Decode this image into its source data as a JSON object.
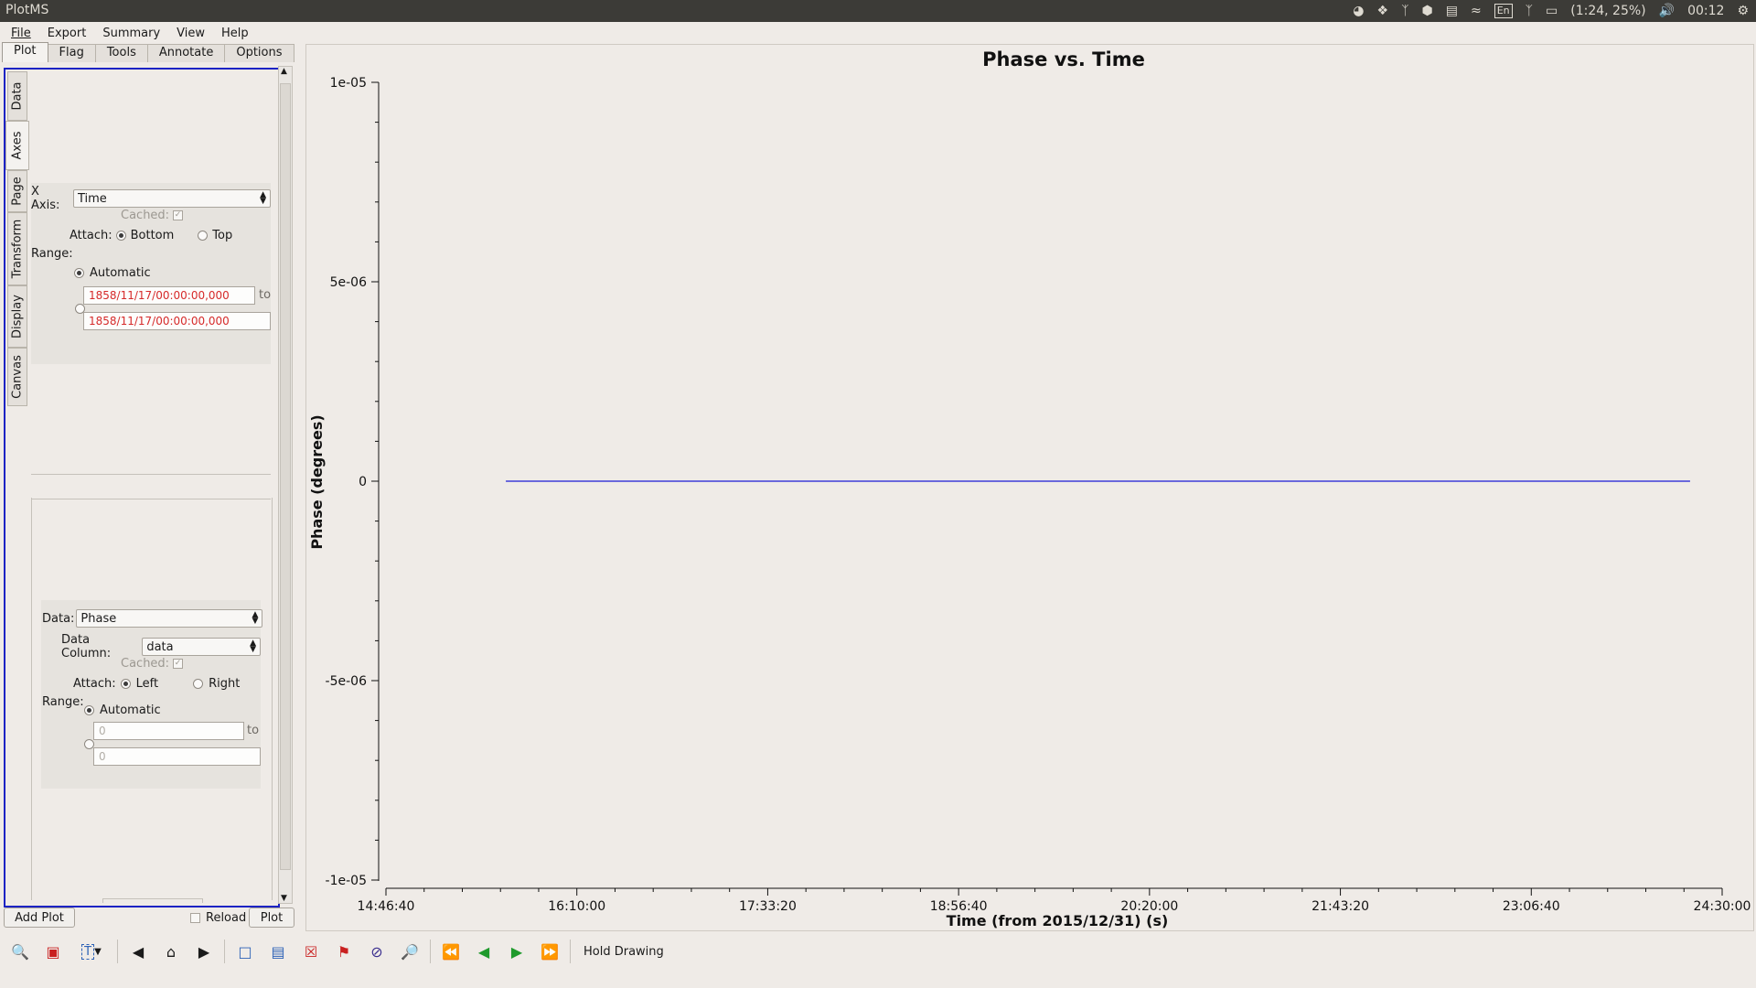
{
  "topbar": {
    "app_title": "PlotMS",
    "tray": {
      "keyboard": "En",
      "battery": "(1:24, 25%)",
      "clock": "00:12"
    }
  },
  "menu": {
    "items": [
      "File",
      "Export",
      "Summary",
      "View",
      "Help"
    ]
  },
  "tabs": [
    "Plot",
    "Flag",
    "Tools",
    "Annotate",
    "Options"
  ],
  "side_tabs": [
    "Data",
    "Axes",
    "Page",
    "Transform",
    "Display",
    "Canvas"
  ],
  "x_axis": {
    "label": "X Axis:",
    "value": "Time",
    "cached_label": "Cached:",
    "attach_label": "Attach:",
    "attach_options": [
      "Bottom",
      "Top"
    ],
    "range_label": "Range:",
    "automatic_label": "Automatic",
    "range_from": "1858/11/17/00:00:00,000",
    "range_to_label": "to",
    "range_to": "1858/11/17/00:00:00,000"
  },
  "y_axis": {
    "data_label": "Data:",
    "data_value": "Phase",
    "column_label": "Data Column:",
    "column_value": "data",
    "cached_label": "Cached:",
    "attach_label": "Attach:",
    "attach_options": [
      "Left",
      "Right"
    ],
    "range_label": "Range:",
    "automatic_label": "Automatic",
    "range_from": "0",
    "range_to_label": "to",
    "range_to": "0"
  },
  "buttons": {
    "add_plot": "Add Plot",
    "reload": "Reload",
    "plot": "Plot"
  },
  "toolbar": {
    "hold_drawing": "Hold Drawing"
  },
  "chart_data": {
    "type": "line",
    "title": "Phase vs. Time",
    "xlabel": "Time (from 2015/12/31) (s)",
    "ylabel": "Phase (degrees)",
    "x_ticks": [
      "14:46:40",
      "16:10:00",
      "17:33:20",
      "18:56:40",
      "20:20:00",
      "21:43:20",
      "23:06:40",
      "24:30:00"
    ],
    "y_ticks": [
      "1e-05",
      "5e-06",
      "0",
      "-5e-06",
      "-1e-05"
    ],
    "ylim": [
      -1e-05,
      1e-05
    ],
    "series": [
      {
        "x": [
          "15:39:00",
          "24:16:00"
        ],
        "y": [
          0,
          0
        ],
        "color": "#1a1ad6"
      }
    ]
  }
}
